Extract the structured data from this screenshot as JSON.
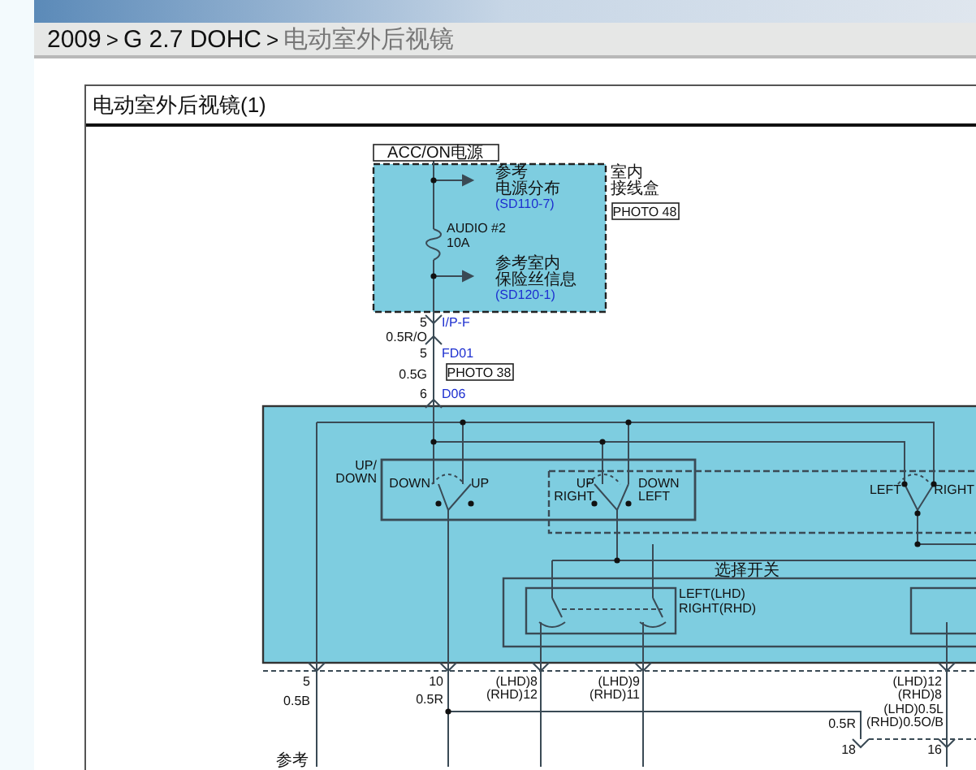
{
  "breadcrumb": [
    {
      "text": "2009",
      "current": false
    },
    {
      "text": "G 2.7 DOHC",
      "current": false
    },
    {
      "text": "电动室外后视镜",
      "current": true
    }
  ],
  "breadcrumb_separator": ">",
  "panel": {
    "title": "电动室外后视镜(1)"
  },
  "diagram": {
    "labels": [
      {
        "text": "ACC/ON电源",
        "kind": "boxed"
      },
      {
        "text": "参考",
        "kind": "plain"
      },
      {
        "text": "电源分布",
        "kind": "plain"
      },
      {
        "text": "(SD110-7)",
        "kind": "link"
      },
      {
        "text": "室内",
        "kind": "plain"
      },
      {
        "text": "接线盒",
        "kind": "plain"
      },
      {
        "text": "PHOTO 48",
        "kind": "boxed"
      },
      {
        "text": "AUDIO #2",
        "kind": "plain"
      },
      {
        "text": "10A",
        "kind": "plain"
      },
      {
        "text": "参考室内",
        "kind": "plain"
      },
      {
        "text": "保险丝信息",
        "kind": "plain"
      },
      {
        "text": "(SD120-1)",
        "kind": "link"
      },
      {
        "text": "5",
        "kind": "plain"
      },
      {
        "text": "I/P-F",
        "kind": "link"
      },
      {
        "text": "0.5R/O",
        "kind": "plain"
      },
      {
        "text": "5",
        "kind": "plain"
      },
      {
        "text": "FD01",
        "kind": "link"
      },
      {
        "text": "0.5G",
        "kind": "plain"
      },
      {
        "text": "PHOTO 38",
        "kind": "boxed"
      },
      {
        "text": "6",
        "kind": "plain"
      },
      {
        "text": "D06",
        "kind": "link"
      },
      {
        "text": "UP/",
        "kind": "plain"
      },
      {
        "text": "DOWN",
        "kind": "plain"
      },
      {
        "text": "DOWN",
        "kind": "plain"
      },
      {
        "text": "UP",
        "kind": "plain"
      },
      {
        "text": "UP",
        "kind": "plain"
      },
      {
        "text": "RIGHT",
        "kind": "plain"
      },
      {
        "text": "DOWN",
        "kind": "plain"
      },
      {
        "text": "LEFT",
        "kind": "plain"
      },
      {
        "text": "LEFT",
        "kind": "plain"
      },
      {
        "text": "RIGHT",
        "kind": "plain"
      },
      {
        "text": "选择开关",
        "kind": "plain"
      },
      {
        "text": "LEFT(LHD)",
        "kind": "plain"
      },
      {
        "text": "RIGHT(RHD)",
        "kind": "plain"
      },
      {
        "text": "5",
        "kind": "plain"
      },
      {
        "text": "0.5B",
        "kind": "plain"
      },
      {
        "text": "10",
        "kind": "plain"
      },
      {
        "text": "0.5R",
        "kind": "plain"
      },
      {
        "text": "(LHD)8",
        "kind": "plain"
      },
      {
        "text": "(RHD)12",
        "kind": "plain"
      },
      {
        "text": "(LHD)9",
        "kind": "plain"
      },
      {
        "text": "(RHD)11",
        "kind": "plain"
      },
      {
        "text": "(LHD)12",
        "kind": "plain"
      },
      {
        "text": "(RHD)8",
        "kind": "plain"
      },
      {
        "text": "(LHD)0.5L",
        "kind": "plain"
      },
      {
        "text": "(RHD)0.5O/B",
        "kind": "plain"
      },
      {
        "text": "0.5R",
        "kind": "plain"
      },
      {
        "text": "18",
        "kind": "plain"
      },
      {
        "text": "16",
        "kind": "plain"
      },
      {
        "text": "参考",
        "kind": "plain"
      }
    ]
  }
}
